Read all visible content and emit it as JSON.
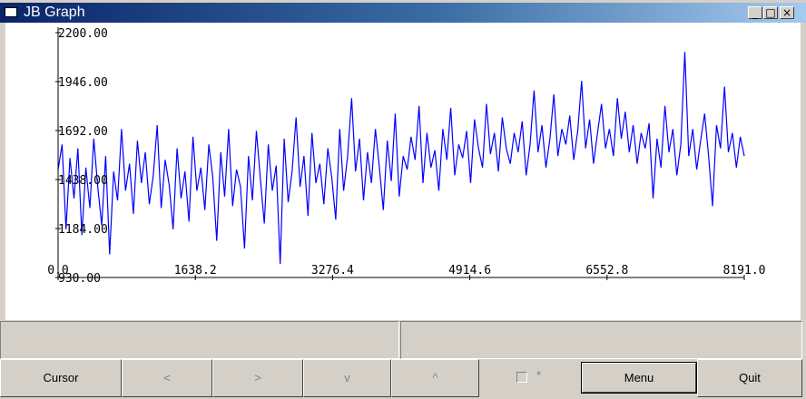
{
  "window": {
    "title": "JB Graph"
  },
  "titlebar_buttons": {
    "minimize": "_",
    "maximize": "□",
    "close": "×"
  },
  "toolbar": {
    "cursor_label": "Cursor",
    "left_label": "<",
    "right_label": ">",
    "down_label": "v",
    "up_label": "^",
    "star_label": "*",
    "menu_label": "Menu",
    "quit_label": "Quit"
  },
  "colors": {
    "series": "#0000ff",
    "titlebar_start": "#0a246a",
    "titlebar_end": "#a6caf0"
  },
  "chart_data": {
    "type": "line",
    "x_ticks": [
      "0.0",
      "1638.2",
      "3276.4",
      "4914.6",
      "6552.8",
      "8191.0"
    ],
    "y_ticks": [
      "2200.00",
      "1946.00",
      "1692.00",
      "1438.00",
      "1184.00",
      "930.00"
    ],
    "xlim": [
      0,
      8191
    ],
    "ylim": [
      930,
      2200
    ],
    "series": [
      {
        "values": [
          1490,
          1620,
          1180,
          1550,
          1340,
          1600,
          1150,
          1500,
          1290,
          1650,
          1400,
          1200,
          1560,
          1050,
          1480,
          1330,
          1700,
          1380,
          1520,
          1260,
          1640,
          1420,
          1580,
          1310,
          1460,
          1720,
          1290,
          1540,
          1410,
          1180,
          1600,
          1340,
          1480,
          1220,
          1660,
          1380,
          1500,
          1280,
          1620,
          1450,
          1120,
          1580,
          1350,
          1700,
          1300,
          1490,
          1400,
          1080,
          1560,
          1330,
          1690,
          1440,
          1210,
          1620,
          1380,
          1510,
          1000,
          1650,
          1320,
          1480,
          1760,
          1400,
          1560,
          1250,
          1680,
          1420,
          1520,
          1310,
          1600,
          1450,
          1230,
          1700,
          1380,
          1560,
          1860,
          1480,
          1650,
          1330,
          1580,
          1420,
          1700,
          1500,
          1280,
          1640,
          1430,
          1780,
          1350,
          1560,
          1490,
          1660,
          1540,
          1820,
          1420,
          1680,
          1500,
          1590,
          1380,
          1700,
          1540,
          1810,
          1460,
          1620,
          1550,
          1690,
          1420,
          1750,
          1600,
          1500,
          1830,
          1570,
          1680,
          1480,
          1760,
          1600,
          1520,
          1680,
          1580,
          1740,
          1460,
          1620,
          1900,
          1580,
          1720,
          1500,
          1650,
          1880,
          1560,
          1700,
          1620,
          1770,
          1540,
          1690,
          1950,
          1600,
          1750,
          1520,
          1680,
          1830,
          1600,
          1700,
          1560,
          1860,
          1650,
          1790,
          1580,
          1720,
          1520,
          1680,
          1600,
          1730,
          1340,
          1650,
          1500,
          1820,
          1580,
          1700,
          1460,
          1620,
          2100,
          1560,
          1700,
          1490,
          1640,
          1780,
          1560,
          1300,
          1720,
          1600,
          1920,
          1580,
          1680,
          1500,
          1660,
          1560
        ]
      }
    ]
  }
}
